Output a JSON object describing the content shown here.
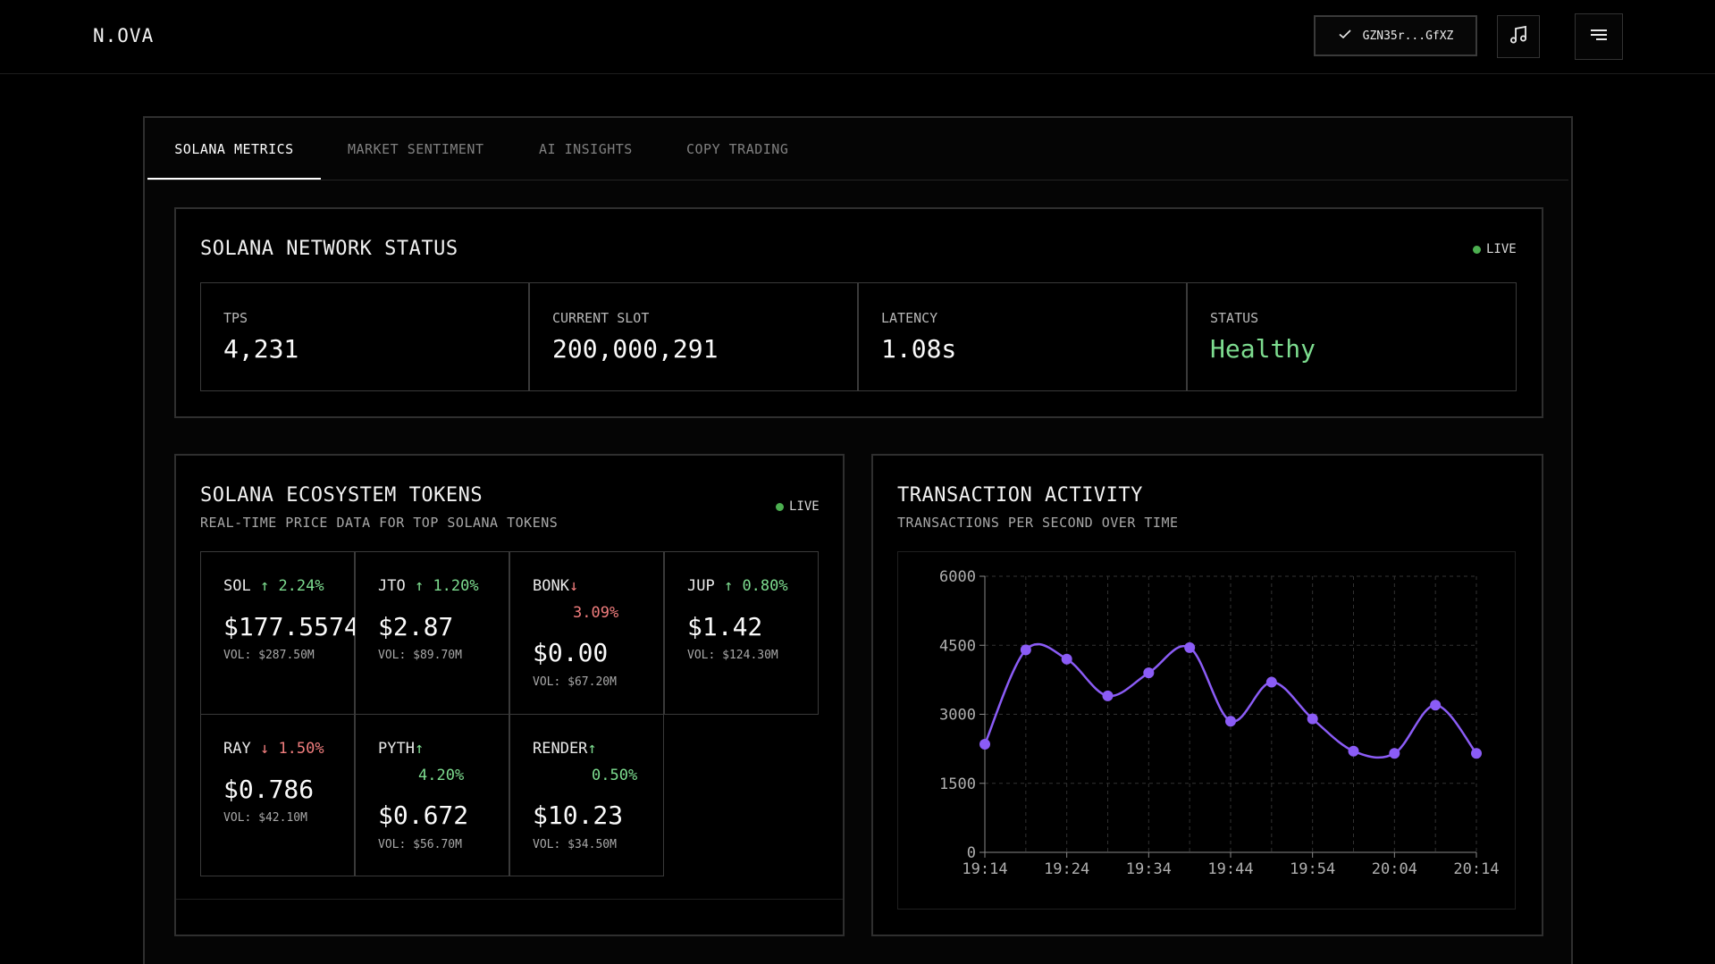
{
  "app": {
    "logo": "N.OVA"
  },
  "header": {
    "wallet_label": "GZN35r...GfXZ"
  },
  "tabs": [
    {
      "label": "SOLANA METRICS",
      "active": true
    },
    {
      "label": "MARKET SENTIMENT",
      "active": false
    },
    {
      "label": "AI INSIGHTS",
      "active": false
    },
    {
      "label": "COPY TRADING",
      "active": false
    }
  ],
  "network": {
    "title": "SOLANA NETWORK STATUS",
    "live_label": "LIVE",
    "stats": [
      {
        "label": "TPS",
        "value": "4,231"
      },
      {
        "label": "CURRENT SLOT",
        "value": "200,000,291"
      },
      {
        "label": "LATENCY",
        "value": "1.08s"
      },
      {
        "label": "STATUS",
        "value": "Healthy",
        "color": "#7ddc8f"
      }
    ]
  },
  "tokens": {
    "title": "SOLANA ECOSYSTEM TOKENS",
    "subtitle": "REAL-TIME PRICE DATA FOR TOP SOLANA TOKENS",
    "live_label": "LIVE",
    "items": [
      {
        "symbol": "SOL",
        "change": "↑ 2.24%",
        "dir": "up",
        "price": "$177.5574",
        "volume": "VOL: $287.50M"
      },
      {
        "symbol": "JTO",
        "change": "↑ 1.20%",
        "dir": "up",
        "price": "$2.87",
        "volume": "VOL: $89.70M"
      },
      {
        "symbol": "BONK",
        "change": "↓",
        "change2": "3.09%",
        "dir": "down",
        "price": "$0.00",
        "volume": "VOL: $67.20M"
      },
      {
        "symbol": "JUP",
        "change": "↑ 0.80%",
        "dir": "up",
        "price": "$1.42",
        "volume": "VOL: $124.30M"
      },
      {
        "symbol": "RAY",
        "change": "↓ 1.50%",
        "dir": "down",
        "price": "$0.786",
        "volume": "VOL: $42.10M"
      },
      {
        "symbol": "PYTH",
        "change": "↑",
        "change2": "4.20%",
        "dir": "up",
        "price": "$0.672",
        "volume": "VOL: $56.70M"
      },
      {
        "symbol": "RENDER",
        "change": "↑",
        "change2": "0.50%",
        "dir": "up",
        "price": "$10.23",
        "volume": "VOL: $34.50M"
      }
    ]
  },
  "activity": {
    "title": "TRANSACTION ACTIVITY",
    "subtitle": "TRANSACTIONS PER SECOND OVER TIME"
  },
  "colors": {
    "accent_line": "#8b5cf6",
    "positive": "#7ddc8f",
    "negative": "#f07d7d",
    "live_dot": "#4caf50"
  },
  "chart_data": {
    "type": "line",
    "title": "TRANSACTION ACTIVITY",
    "subtitle": "TRANSACTIONS PER SECOND OVER TIME",
    "xlabel": "",
    "ylabel": "",
    "x": [
      "19:14",
      "19:19",
      "19:24",
      "19:29",
      "19:34",
      "19:39",
      "19:44",
      "19:49",
      "19:54",
      "19:59",
      "20:04",
      "20:09",
      "20:14"
    ],
    "x_tick_labels": [
      "19:14",
      "19:24",
      "19:34",
      "19:44",
      "19:54",
      "20:04",
      "20:14"
    ],
    "y_ticks": [
      0,
      1500,
      3000,
      4500,
      6000
    ],
    "ylim": [
      0,
      6000
    ],
    "grid": true,
    "series": [
      {
        "values": [
          2350,
          4400,
          4200,
          3400,
          3900,
          4450,
          2850,
          3700,
          2900,
          2200,
          2150,
          3200,
          2150
        ]
      }
    ]
  }
}
